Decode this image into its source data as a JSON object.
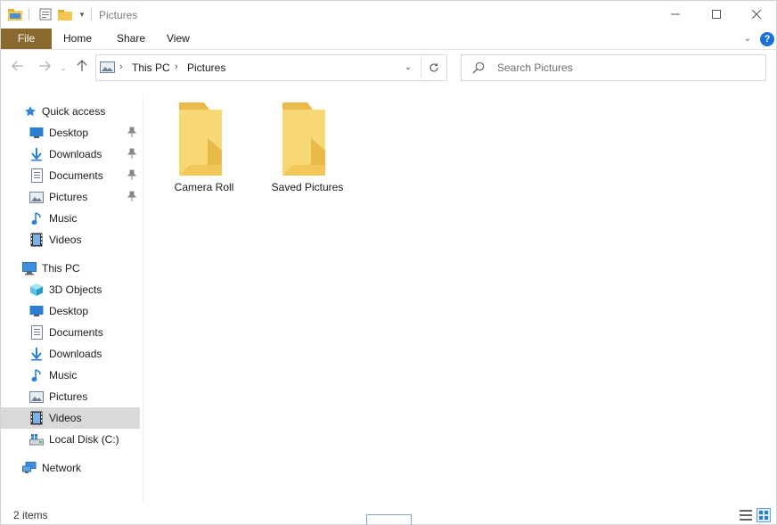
{
  "window": {
    "title": "Pictures"
  },
  "ribbon": {
    "tabs": [
      "File",
      "Home",
      "Share",
      "View"
    ]
  },
  "navigation": {
    "breadcrumb": [
      "This PC",
      "Pictures"
    ],
    "search_placeholder": "Search Pictures"
  },
  "sidebar": {
    "quick_access": {
      "label": "Quick access",
      "items": [
        {
          "label": "Desktop",
          "icon": "desktop-icon",
          "pinned": true
        },
        {
          "label": "Downloads",
          "icon": "downloads-icon",
          "pinned": true
        },
        {
          "label": "Documents",
          "icon": "documents-icon",
          "pinned": true
        },
        {
          "label": "Pictures",
          "icon": "pictures-icon",
          "pinned": true
        },
        {
          "label": "Music",
          "icon": "music-icon",
          "pinned": false
        },
        {
          "label": "Videos",
          "icon": "videos-icon",
          "pinned": false
        }
      ]
    },
    "this_pc": {
      "label": "This PC",
      "items": [
        {
          "label": "3D Objects",
          "icon": "3d-objects-icon"
        },
        {
          "label": "Desktop",
          "icon": "desktop-icon"
        },
        {
          "label": "Documents",
          "icon": "documents-icon"
        },
        {
          "label": "Downloads",
          "icon": "downloads-icon"
        },
        {
          "label": "Music",
          "icon": "music-icon"
        },
        {
          "label": "Pictures",
          "icon": "pictures-icon"
        },
        {
          "label": "Videos",
          "icon": "videos-icon",
          "selected": true
        },
        {
          "label": "Local Disk (C:)",
          "icon": "local-disk-icon"
        }
      ]
    },
    "network": {
      "label": "Network"
    }
  },
  "content": {
    "folders": [
      {
        "name": "Camera Roll"
      },
      {
        "name": "Saved Pictures"
      }
    ]
  },
  "status": {
    "item_count": "2 items"
  },
  "colors": {
    "file_tab": "#8a6a2f",
    "selected_row": "#d9d9d9",
    "folder_yellow": "#f8d775"
  }
}
